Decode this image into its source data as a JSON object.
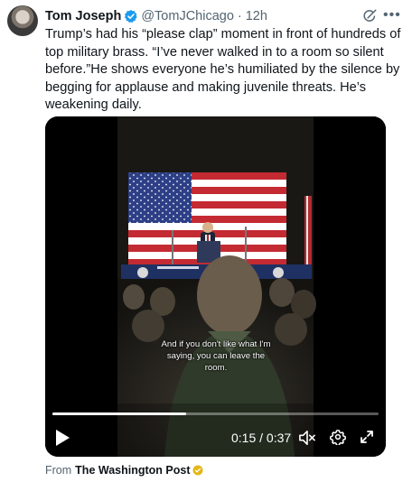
{
  "author": {
    "name": "Tom Joseph",
    "handle": "@TomJChicago",
    "separator": "·",
    "time": "12h"
  },
  "icons": {
    "verified": "verified-badge-icon",
    "grok": "grok-icon",
    "more": "more-icon",
    "play": "play-icon",
    "mute": "volume-muted-icon",
    "settings": "gear-icon",
    "fullscreen": "fullscreen-icon",
    "source_badge": "gold-verified-icon"
  },
  "colors": {
    "verified_blue": "#1d9bf0",
    "text_primary": "#0f1419",
    "text_secondary": "#536471",
    "gold_badge": "#e2b719"
  },
  "tweet": {
    "text": "Trump’s had his “please clap” moment in front of hundreds of top military brass. “I’ve never walked in to a room so silent before.”He shows everyone he’s humiliated by the silence by begging for applause and making juvenile threats. He’s weakening daily."
  },
  "video": {
    "caption_line1": "And if you don't like what I'm",
    "caption_line2": "saying, you can leave the room.",
    "progress_fraction": 0.41,
    "time_display": "0:15 / 0:37"
  },
  "source": {
    "prefix": "From",
    "name": "The Washington Post"
  }
}
